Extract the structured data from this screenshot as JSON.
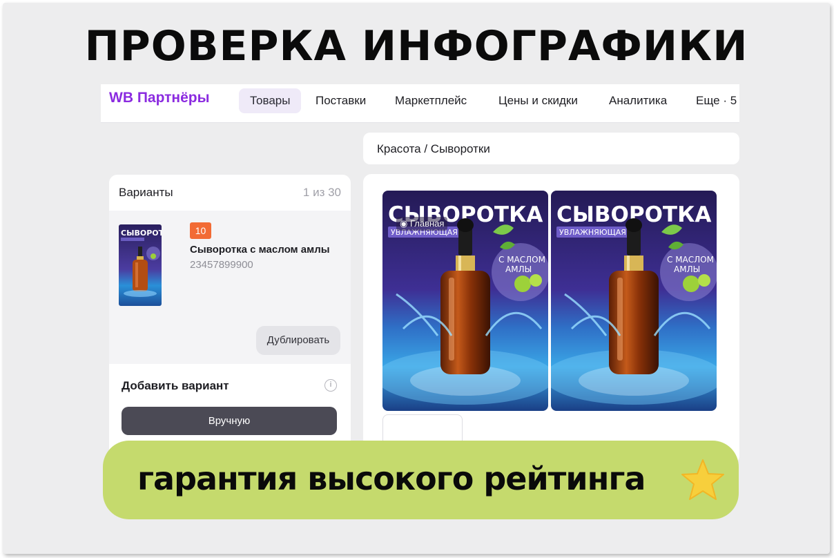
{
  "headline": "ПРОВЕРКА ИНФОГРАФИКИ",
  "nav": {
    "brand": "WB Партнёры",
    "tabs": [
      "Товары",
      "Поставки",
      "Маркетплейс",
      "Цены и скидки",
      "Аналитика",
      "Еще · 5"
    ],
    "active_tab": "Товары"
  },
  "breadcrumb": "Красота  /  Сыворотки",
  "variants": {
    "title": "Варианты",
    "count": "1 из 30",
    "item": {
      "badge": "10",
      "name": "Сыворотка с маслом амлы",
      "sku": "23457899900"
    },
    "duplicate_label": "Дублировать",
    "add_title": "Добавить вариант",
    "manual_label": "Вручную"
  },
  "gallery": {
    "main_label": "Главная",
    "photo_title": "СЫВОРОТКА",
    "photo_subtitle": "УВЛАЖНЯЮЩАЯ",
    "photo_badge_line1": "С МАСЛОМ",
    "photo_badge_line2": "АМЛЫ",
    "thumb_title": "СЫВОРОТКА",
    "thumb_subtitle": "УВЛАЖНЯЮЩАЯ"
  },
  "banner": {
    "text": "гарантия высокого рейтинга",
    "icon": "star-icon"
  },
  "colors": {
    "brand": "#8b2be0",
    "badge": "#f26b35",
    "banner": "#c5da6d",
    "dark_button": "#4b4a55"
  }
}
